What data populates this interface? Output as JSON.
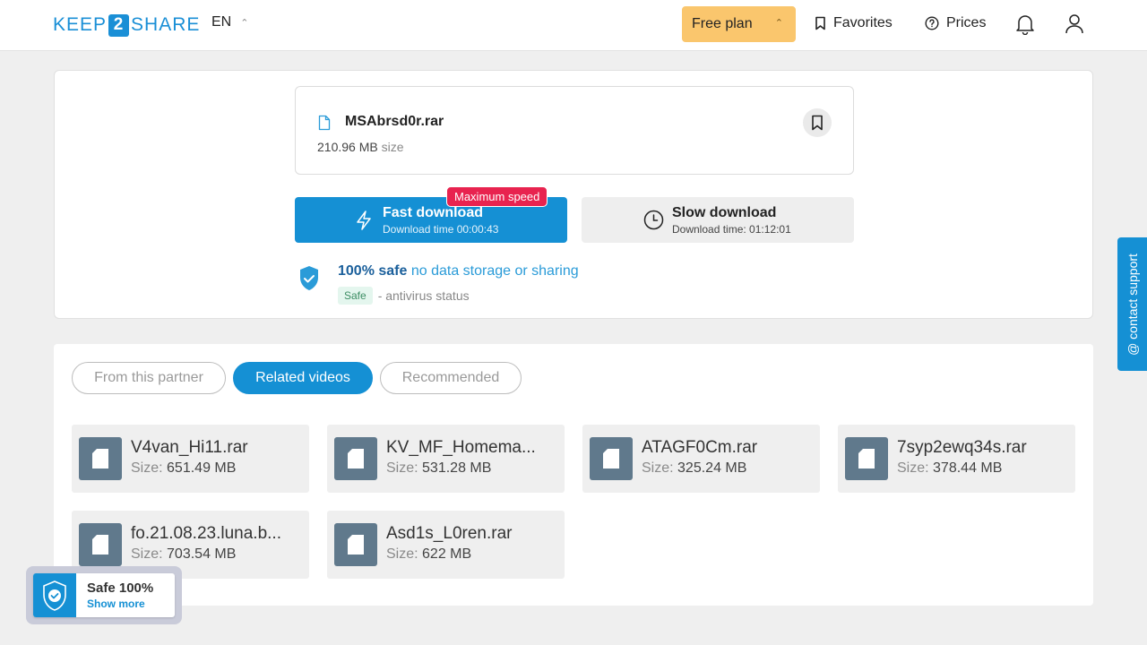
{
  "header": {
    "logo_left": "KEEP",
    "logo_mid": "2",
    "logo_right": "SHARE",
    "language": "EN",
    "free_plan": "Free plan",
    "favorites": "Favorites",
    "prices": "Prices"
  },
  "file": {
    "name": "MSAbrsd0r.rar",
    "size_value": "210.96 MB",
    "size_label": "size"
  },
  "download": {
    "fast_label": "Fast download",
    "fast_time": "Download time 00:00:43",
    "badge": "Maximum speed",
    "slow_label": "Slow download",
    "slow_time": "Download time: 01:12:01"
  },
  "safety": {
    "bold": "100% safe",
    "rest": "no data storage or sharing",
    "pill": "Safe",
    "status": "- antivirus status"
  },
  "tabs": [
    {
      "label": "From this partner",
      "active": false
    },
    {
      "label": "Related videos",
      "active": true
    },
    {
      "label": "Recommended",
      "active": false
    }
  ],
  "items": [
    {
      "name": "V4van_Hi11.rar",
      "size_label": "Size:",
      "size": "651.49 MB"
    },
    {
      "name": "KV_MF_Homema...",
      "size_label": "Size:",
      "size": "531.28 MB"
    },
    {
      "name": "ATAGF0Cm.rar",
      "size_label": "Size:",
      "size": "325.24 MB"
    },
    {
      "name": "7syp2ewq34s.rar",
      "size_label": "Size:",
      "size": "378.44 MB"
    },
    {
      "name": "fo.21.08.23.luna.b...",
      "size_label": "Size:",
      "size": "703.54 MB"
    },
    {
      "name": "Asd1s_L0ren.rar",
      "size_label": "Size:",
      "size": "622 MB"
    }
  ],
  "support": "@ contact support",
  "safe_badge": {
    "title": "Safe 100%",
    "link": "Show more"
  },
  "colors": {
    "accent": "#1590d4",
    "plan": "#fac66d",
    "badge": "#e8234f",
    "icon_bg": "#60798c"
  }
}
